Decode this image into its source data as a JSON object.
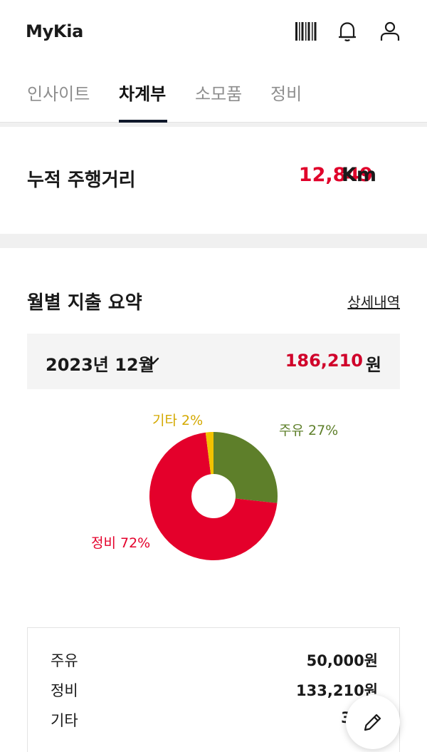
{
  "app": {
    "title": "MyKia"
  },
  "header_icons": [
    "barcode-icon",
    "bell-icon",
    "user-icon"
  ],
  "tabs": [
    {
      "label": "인사이트",
      "active": false
    },
    {
      "label": "차계부",
      "active": true
    },
    {
      "label": "소모품",
      "active": false
    },
    {
      "label": "정비",
      "active": false
    }
  ],
  "mileage": {
    "label": "누적 주행거리",
    "value": "12,849",
    "unit": "Km"
  },
  "expense": {
    "title": "월별 지출 요약",
    "detail_link": "상세내역",
    "month": "2023년 12월",
    "total": "186,210",
    "total_unit": "원"
  },
  "chart_data": {
    "type": "pie",
    "series": [
      {
        "name": "주유",
        "value": 27,
        "color": "#5e7f2a",
        "label": "주유 27%"
      },
      {
        "name": "정비",
        "value": 72,
        "color": "#e4002b",
        "label": "정비 72%"
      },
      {
        "name": "기타",
        "value": 2,
        "color": "#f2c200",
        "label": "기타 2%"
      }
    ]
  },
  "summary": [
    {
      "name": "주유",
      "amount": "50,000원"
    },
    {
      "name": "정비",
      "amount": "133,210원"
    },
    {
      "name": "기타",
      "amount": "3,00"
    }
  ],
  "colors": {
    "accent": "#e0002a",
    "tab_indicator": "#10182a"
  },
  "fab_icon": "pencil-icon"
}
